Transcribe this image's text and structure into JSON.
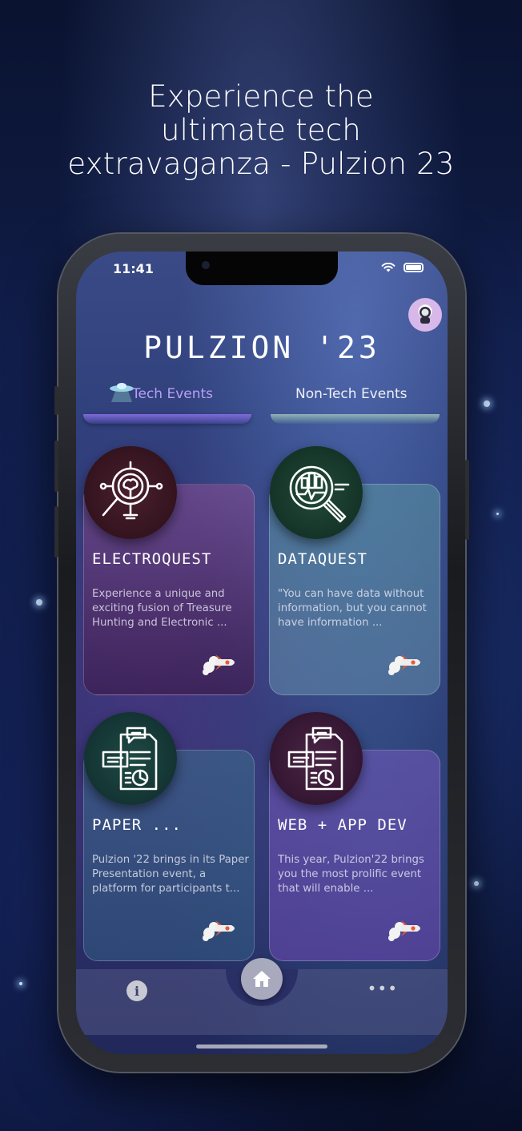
{
  "promo": {
    "headline": "Experience the\nultimate tech\nextravaganza - Pulzion 23"
  },
  "status_bar": {
    "time": "11:41"
  },
  "app": {
    "title": "PULZION '23"
  },
  "tabs": [
    {
      "label": "Tech Events",
      "selected": true
    },
    {
      "label": "Non-Tech Events",
      "selected": false
    }
  ],
  "events": [
    {
      "title": "ELECTROQUEST",
      "description": "Experience a unique and exciting fusion of Treasure Hunting and Electronic ..."
    },
    {
      "title": "DATAQUEST",
      "description": "\"You can have data without information, but you cannot have information ..."
    },
    {
      "title": "PAPER ...",
      "description": "Pulzion '22 brings in its Paper Presentation event, a platform for participants t..."
    },
    {
      "title": "WEB + APP DEV",
      "description": "This year, Pulzion'22 brings you the most prolific event that will enable ..."
    }
  ],
  "bottom_nav": {
    "info_label": "i",
    "more_label": "•••"
  },
  "colors": {
    "selected_tab": "#b89ff5",
    "accent_tab_tech": "#7f6ad9",
    "accent_tab_non": "#8fb3b5"
  }
}
